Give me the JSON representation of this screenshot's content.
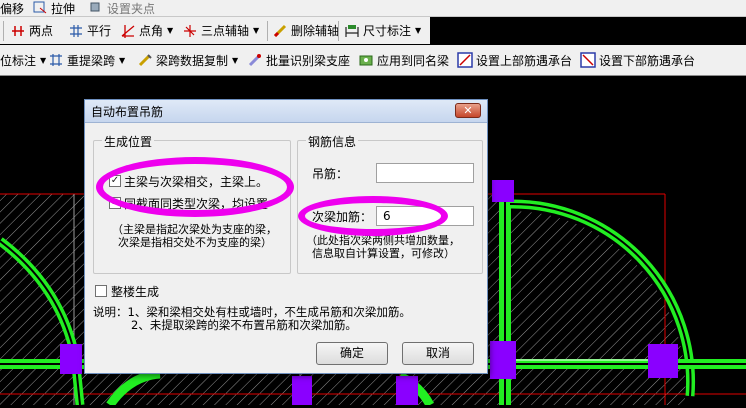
{
  "toolbar_top": {
    "items": [
      {
        "icon": "move-icon",
        "label": "偏移"
      },
      {
        "icon": "stretch-icon",
        "label": "拉伸"
      },
      {
        "icon": "grip-icon",
        "label": "设置夹点"
      }
    ]
  },
  "toolbar_row1": {
    "items": [
      {
        "icon": "two-point-axis-icon",
        "label": "两点",
        "dropdown": false
      },
      {
        "icon": "parallel-axis-icon",
        "label": "平行",
        "dropdown": false
      },
      {
        "icon": "point-angle-icon",
        "label": "点角",
        "dropdown": true
      },
      {
        "icon": "three-point-axis-icon",
        "label": "三点辅轴",
        "dropdown": true
      },
      {
        "icon": "delete-axis-icon",
        "label": "删除辅轴",
        "dropdown": false
      },
      {
        "icon": "dimension-icon",
        "label": "尺寸标注",
        "dropdown": true
      }
    ]
  },
  "toolbar_row2": {
    "items": [
      {
        "icon": "",
        "label": "位标注",
        "dropdown": true
      },
      {
        "icon": "relift-span-icon",
        "label": "重提梁跨",
        "dropdown": true
      },
      {
        "icon": "copy-span-data-icon",
        "label": "梁跨数据复制",
        "dropdown": true
      },
      {
        "icon": "batch-identify-icon",
        "label": "批量识别梁支座",
        "dropdown": false
      },
      {
        "icon": "apply-same-icon",
        "label": "应用到同名梁",
        "dropdown": false
      },
      {
        "icon": "top-rebar-icon",
        "label": "设置上部筋遇承台",
        "dropdown": false
      },
      {
        "icon": "bottom-rebar-icon",
        "label": "设置下部筋遇承台",
        "dropdown": false
      }
    ]
  },
  "dialog": {
    "title": "自动布置吊筋",
    "close_label": "✕",
    "position_group": {
      "title": "生成位置",
      "options": [
        {
          "label": "主梁与次梁相交，主梁上。",
          "checked": true
        },
        {
          "label": "同截面同类型次梁，均设置",
          "checked": true
        }
      ],
      "note_line1": "（主梁是指起次梁处为支座的梁，",
      "note_line2": "次梁是指相交处不为支座的梁）"
    },
    "rebar_group": {
      "title": "钢筋信息",
      "hanger_label": "吊筋：",
      "hanger_value": "",
      "secondary_label": "次梁加筋：",
      "secondary_value": "6",
      "note_line1": "（此处指次梁两侧共增加数量，",
      "note_line2": "信息取自计算设置，可修改）"
    },
    "whole_building": {
      "label": "整楼生成",
      "checked": false
    },
    "explanation_line1": "说明：1、梁和梁相交处有柱或墙时，不生成吊筋和次梁加筋。",
    "explanation_line2": "2、未提取梁跨的梁不布置吊筋和次梁加筋。",
    "ok_label": "确定",
    "cancel_label": "取消"
  },
  "colors": {
    "canvas_bg": "#000000",
    "beam_green": "#22ee22",
    "support_purple": "#8a00ff",
    "frame_red": "#ff0000",
    "annotation_magenta": "#ee00ee"
  }
}
